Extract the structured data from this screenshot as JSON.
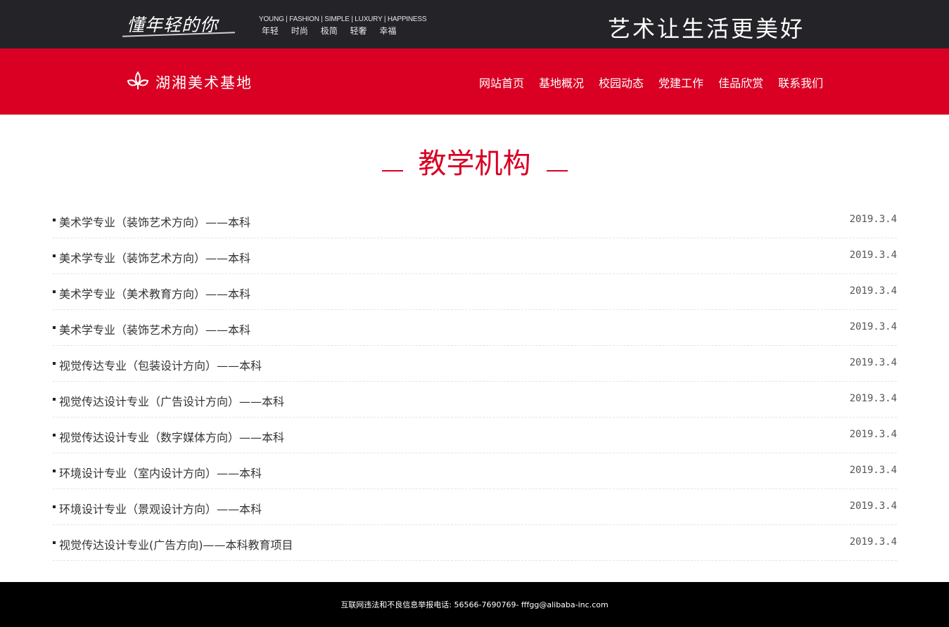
{
  "header": {
    "slogan_script": "懂年轻的你",
    "tagline_en": "YOUNG | FASHION | SIMPLE | LUXURY | HAPPINESS",
    "tagline_cn": [
      "年轻",
      "时尚",
      "极简",
      "轻奢",
      "幸福"
    ],
    "motto": "艺术让生活更美好"
  },
  "brand": {
    "name": "湖湘美术基地",
    "logo_icon": "leaf-logo-icon"
  },
  "nav": {
    "items": [
      {
        "label": "网站首页"
      },
      {
        "label": "基地概况"
      },
      {
        "label": "校园动态"
      },
      {
        "label": "党建工作"
      },
      {
        "label": "佳品欣赏"
      },
      {
        "label": "联系我们"
      }
    ]
  },
  "main": {
    "title": "教学机构",
    "items": [
      {
        "title": "美术学专业（装饰艺术方向）——本科",
        "date": "2019.3.4"
      },
      {
        "title": "美术学专业（装饰艺术方向）——本科",
        "date": "2019.3.4"
      },
      {
        "title": "美术学专业（美术教育方向）——本科",
        "date": "2019.3.4"
      },
      {
        "title": "美术学专业（装饰艺术方向）——本科",
        "date": "2019.3.4"
      },
      {
        "title": "视觉传达专业（包装设计方向）——本科",
        "date": "2019.3.4"
      },
      {
        "title": "视觉传达设计专业（广告设计方向）——本科",
        "date": "2019.3.4"
      },
      {
        "title": "视觉传达设计专业（数字媒体方向）——本科",
        "date": "2019.3.4"
      },
      {
        "title": "环境设计专业（室内设计方向）——本科",
        "date": "2019.3.4"
      },
      {
        "title": "环境设计专业（景观设计方向）——本科",
        "date": "2019.3.4"
      },
      {
        "title": "视觉传达设计专业(广告方向)——本科教育项目",
        "date": "2019.3.4"
      }
    ]
  },
  "footer": {
    "text": "互联网违法和不良信息举报电话: 56566-7690769- fffgg@alibaba-inc.com"
  },
  "colors": {
    "primary_red": "#d90023",
    "top_bar": "#232328",
    "footer": "#000000"
  }
}
